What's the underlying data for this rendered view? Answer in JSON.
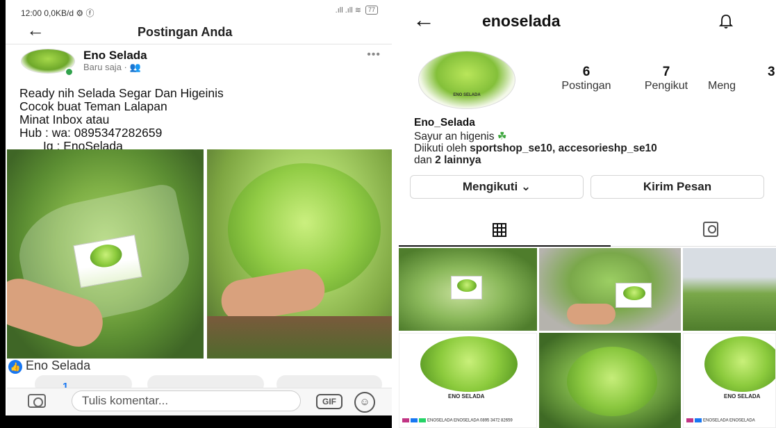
{
  "facebook": {
    "status_bar": {
      "left": "12:00  0,0KB/d ⚙ ⓕ",
      "right": ".ıll .ıll ≋",
      "battery": "77"
    },
    "header": {
      "title": "Postingan Anda"
    },
    "post": {
      "author": "Eno Selada",
      "meta": "Baru saja · 👥",
      "text_lines": [
        "Ready nih Selada Segar Dan Higeinis",
        "Cocok buat Teman Lalapan",
        "Minat Inbox atau",
        "Hub : wa: 0895347282659",
        "       Ig : EnoSelada"
      ],
      "liker": "Eno Selada",
      "like_count": "1"
    },
    "comment_bar": {
      "placeholder": "Tulis komentar...",
      "gif_label": "GIF"
    }
  },
  "instagram": {
    "username": "enoselada",
    "profile_pic_label": "ENO SELADA",
    "stats": [
      {
        "value": "6",
        "label": "Postingan"
      },
      {
        "value": "7",
        "label": "Pengikut"
      },
      {
        "value": "3",
        "label": "Meng"
      }
    ],
    "bio_name": "Eno_Selada",
    "bio_text": "Sayur an higenis",
    "bio_emoji": "☘",
    "followed_prefix": "Diikuti oleh ",
    "followed_users": "sportshop_se10, accesorieshp_se10",
    "followed_suffix_prefix": "dan ",
    "followed_others": "2 lainnya",
    "buttons": {
      "follow": "Mengikuti ⌄",
      "message": "Kirim Pesan"
    },
    "tiles": {
      "brand_label": "ENO SELADA",
      "strip_text": "ENOSELADA  ENOSELADA  0895 3472 82659",
      "strip_text_short": "ENOSELADA  ENOSELADA"
    }
  }
}
